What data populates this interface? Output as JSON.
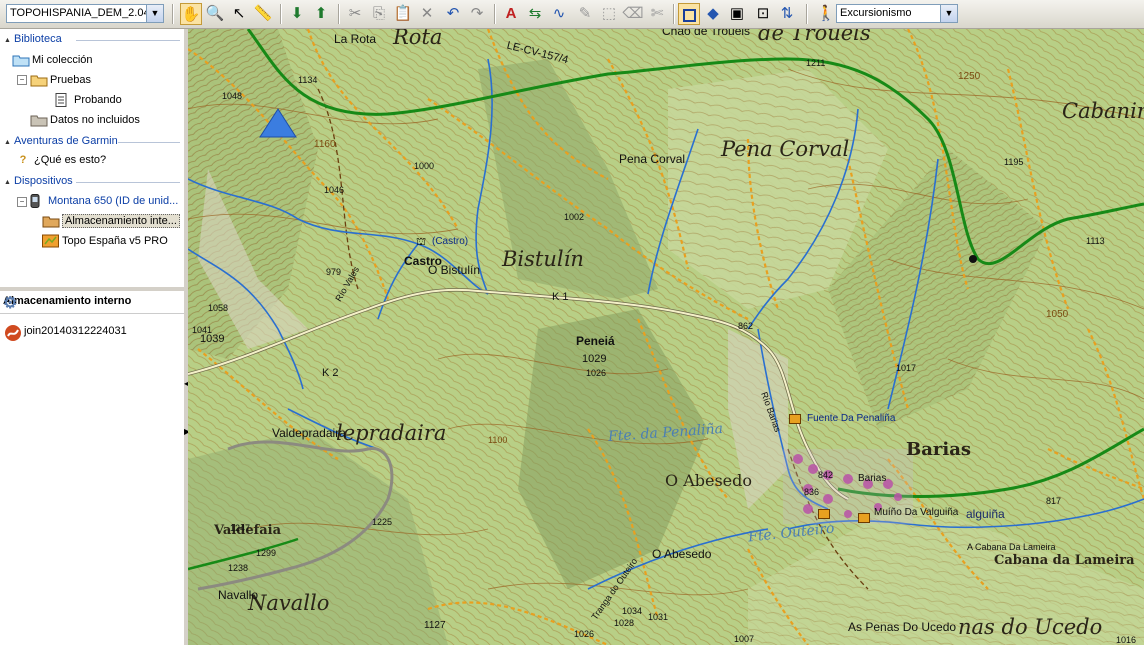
{
  "toolbar": {
    "map_product": "TOPOHISPANIA_DEM_2.04",
    "profile": "Excursionismo",
    "tools": [
      "hand-icon",
      "zoom-icon",
      "select-icon",
      "measure-icon",
      "download-icon",
      "send-icon",
      "cut-icon",
      "copy-icon",
      "paste-icon",
      "delete-icon",
      "undo-icon",
      "redo-icon",
      "waypoint-icon",
      "route-icon",
      "track-icon",
      "edit-icon",
      "select-area-icon",
      "eraser-icon",
      "split-icon",
      "map-view-icon",
      "3d-view-icon",
      "map-layers-icon",
      "fit-icon",
      "sync-icon",
      "profile-icon"
    ]
  },
  "tree": {
    "library_header": "Biblioteca",
    "my_collection": "Mi colección",
    "pruebas": "Pruebas",
    "probando": "Probando",
    "unlisted": "Datos no incluidos",
    "adventures_header": "Aventuras de Garmin",
    "what_is_this": "¿Qué es esto?",
    "devices_header": "Dispositivos",
    "device": "Montana 650 (ID  de unid...",
    "internal_storage": "Almacenamiento inte...",
    "topo": "Topo España v5 PRO"
  },
  "panel2": {
    "title": "Almacenamiento interno",
    "item": "join20140312224031"
  },
  "map": {
    "big_labels": {
      "rota": "Rota",
      "trouels": "de Trouels",
      "cabanin": "Cabanin",
      "pena_corval": "Pena Corval",
      "bistulin": "Bistulín",
      "valdepradaira": "lepradaira",
      "barias": "Barias",
      "o_abesedo": "O Abesedo",
      "valdefaia": "Valdefaia",
      "navallo": "Navallo",
      "cabana_lameira": "Cabana da Lameira",
      "ucedo": "nas do Ucedo"
    },
    "places": {
      "la_rota": "La Rota",
      "pena_corval": "Pena Corval",
      "castro": "(Castro)",
      "castro_lbl": "Castro",
      "o_bistulin": "O Bistulín",
      "penela": "Peneiá",
      "valdepradaira": "Valdepradaira",
      "o_abesedo": "O Abesedo",
      "navallo": "Navallo",
      "barias": "Barias",
      "cabana_lameira": "A Cabana Da Lameira",
      "penas_ucedo": "As Penas Do Ucedo",
      "chao_trouels": "Chao de Trouels"
    },
    "pois": {
      "fuente": "Fuente Da Penaliña",
      "muino": "Muíño Da Valguiña",
      "valguina": "alguiña"
    },
    "roads": {
      "lecv": "LE-CV-157/4",
      "k1": "K 1",
      "k2": "K 2",
      "rio_vales": "Río Vales",
      "rio_barias": "Río Barias",
      "tranga": "Tranga do Outeiro"
    },
    "rivers": {
      "penalina": "Fte. da Penaliña",
      "outeiro": "Fte. Outeiro"
    },
    "elevations": {
      "e1134": "1134",
      "e1048": "1048",
      "e1160": "1160",
      "e1000": "1000",
      "e1046": "1046",
      "e1211": "1211",
      "e1250": "1250",
      "e1195": "1195",
      "e1113": "1113",
      "e1002": "1002",
      "e979": "979",
      "e1058": "1058",
      "e1041": "1041",
      "e1039": "1039",
      "e862": "862",
      "e1029": "1029",
      "e1026": "1026",
      "e1100": "1100",
      "e1017": "1017",
      "e1050": "1050",
      "e842": "842",
      "e836": "836",
      "e817": "817",
      "e1247": "1247",
      "e1225": "1225",
      "e1299": "1299",
      "e1238": "1238",
      "e1127": "1127",
      "e1034": "1034",
      "e1028": "1028",
      "e1031": "1031",
      "e1026b": "1026",
      "e1007": "1007",
      "e1016": "1016"
    }
  }
}
